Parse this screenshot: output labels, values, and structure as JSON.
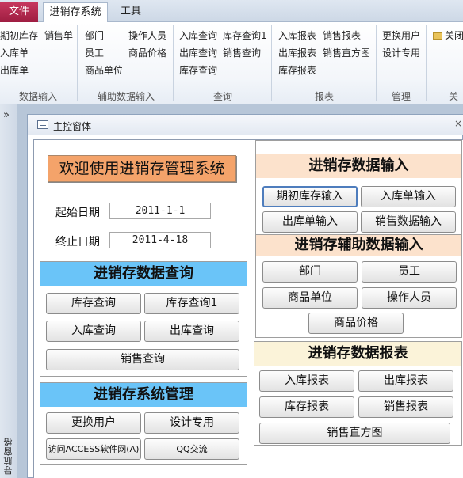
{
  "tabs": {
    "file": "文件",
    "active": "进销存系统",
    "tools": "工具"
  },
  "ribbon": {
    "data_input": {
      "items": [
        "期初库存",
        "销售单",
        "入库单",
        "出库单"
      ],
      "label": "数据输入"
    },
    "aux_input": {
      "items": [
        "部门",
        "操作人员",
        "员工",
        "商品价格",
        "商品单位"
      ],
      "label": "辅助数据输入"
    },
    "query": {
      "items": [
        "入库查询",
        "库存查询1",
        "出库查询",
        "销售查询",
        "库存查询"
      ],
      "label": "查询"
    },
    "reports": {
      "items": [
        "入库报表",
        "销售报表",
        "出库报表",
        "销售直方图",
        "库存报表"
      ],
      "label": "报表"
    },
    "manage": {
      "items": [
        "更换用户",
        "设计专用"
      ],
      "label": "管理"
    },
    "close": {
      "item": "关闭",
      "label": "关"
    }
  },
  "navpane": {
    "chevron": "»",
    "label": "导航窗格"
  },
  "form": {
    "tab_title": "主控窗体",
    "close": "×",
    "welcome": "欢迎使用进销存管理系统",
    "start_label": "起始日期",
    "start_value": "2011-1-1",
    "end_label": "终止日期",
    "end_value": "2011-4-18",
    "query_panel": {
      "title": "进销存数据查询",
      "buttons": [
        "库存查询",
        "库存查询1",
        "入库查询",
        "出库查询",
        "销售查询"
      ]
    },
    "sys_panel": {
      "title": "进销存系统管理",
      "buttons": [
        "更换用户",
        "设计专用",
        "访问ACCESS软件网(A)",
        "QQ交流"
      ]
    },
    "input_panel": {
      "title": "进销存数据输入",
      "buttons": [
        "期初库存输入",
        "入库单输入",
        "出库单输入",
        "销售数据输入"
      ]
    },
    "aux_panel": {
      "title": "进销存辅助数据输入",
      "buttons": [
        "部门",
        "员工",
        "商品单位",
        "操作人员",
        "商品价格"
      ]
    },
    "report_panel": {
      "title": "进销存数据报表",
      "buttons": [
        "入库报表",
        "出库报表",
        "库存报表",
        "销售报表",
        "销售直方图"
      ]
    }
  },
  "colors": {
    "file_tab": "#b02a50",
    "welcome_bg": "#f4a36a",
    "header_blue": "#6ac4f8",
    "header_peach": "#fce2cc",
    "header_cream": "#fbf3d9",
    "workspace": "#b7c6d8"
  }
}
